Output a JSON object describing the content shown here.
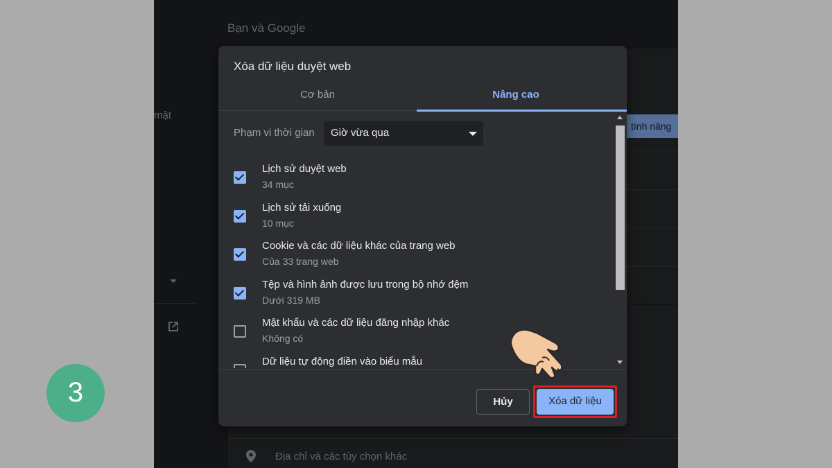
{
  "background": {
    "section_heading": "Bạn và Google",
    "left_fragment": "mật",
    "chip_fragment": "tính năng",
    "location_row_label": "Địa chỉ và các tùy chọn khác"
  },
  "dialog": {
    "title": "Xóa dữ liệu duyệt web",
    "tabs": [
      {
        "label": "Cơ bản",
        "selected": false
      },
      {
        "label": "Nâng cao",
        "selected": true
      }
    ],
    "time_range": {
      "label": "Phạm vi thời gian",
      "value": "Giờ vừa qua"
    },
    "items": [
      {
        "title": "Lịch sử duyệt web",
        "subtitle": "34 mục",
        "checked": true
      },
      {
        "title": "Lịch sử tải xuống",
        "subtitle": "10 mục",
        "checked": true
      },
      {
        "title": "Cookie và các dữ liệu khác của trang web",
        "subtitle": "Của 33 trang web",
        "checked": true
      },
      {
        "title": "Tệp và hình ảnh được lưu trong bộ nhớ đệm",
        "subtitle": "Dưới 319 MB",
        "checked": true
      },
      {
        "title": "Mật khẩu và các dữ liệu đăng nhập khác",
        "subtitle": "Không có",
        "checked": false
      },
      {
        "title": "Dữ liệu tự động điền vào biểu mẫu",
        "subtitle": "",
        "checked": false
      }
    ],
    "buttons": {
      "cancel_label": "Hủy",
      "clear_label": "Xóa dữ liệu"
    }
  },
  "step_badge": "3",
  "colors": {
    "accent": "#8ab4f8",
    "dialog_bg": "#2d2e31",
    "page_bg": "#202124",
    "highlight_border": "#d92025",
    "badge": "#4caf89"
  },
  "icons": [
    "launch-icon",
    "location-pin-icon",
    "dropdown-arrow-icon",
    "pointing-hand-icon",
    "checkbox-checked-icon",
    "checkbox-unchecked-icon"
  ]
}
